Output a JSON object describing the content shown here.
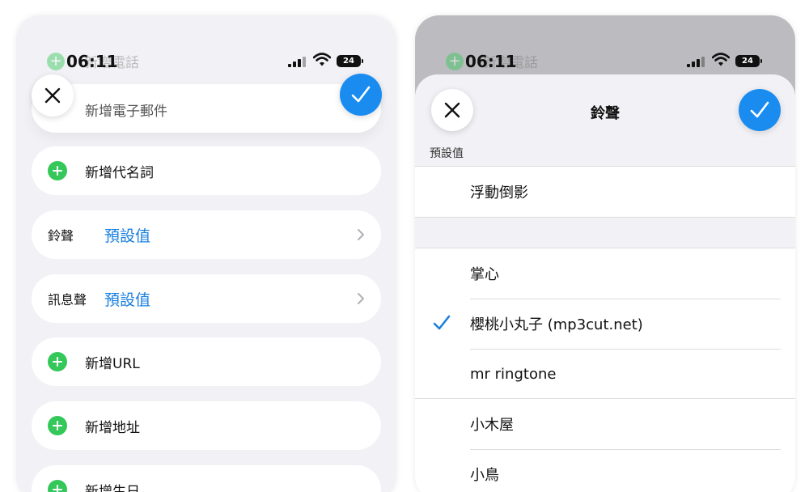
{
  "left": {
    "status": {
      "time": "06:11",
      "battery": "24"
    },
    "ghost_row_label": "新增電話",
    "email_row_label": "新增電子郵件",
    "rows": {
      "pronoun": "新增代名詞",
      "ringtone_key": "鈴聲",
      "ringtone_value": "預設值",
      "msg_key": "訊息聲",
      "msg_value": "預設值",
      "url": "新增URL",
      "address": "新增地址",
      "birthday": "新增生日"
    }
  },
  "right": {
    "status": {
      "time": "06:11",
      "battery": "24"
    },
    "ghost_row_label": "新增電話",
    "sheet_title": "鈴聲",
    "section_header": "預設值",
    "group1": [
      "浮動倒影"
    ],
    "group2": [
      "掌心",
      "櫻桃小丸子 (mp3cut.net)",
      "mr ringtone"
    ],
    "group3": [
      "小木屋",
      "小鳥"
    ],
    "selected_item": "櫻桃小丸子 (mp3cut.net)"
  },
  "colors": {
    "accent": "#1a8cf0",
    "link_blue": "#1a7fe0",
    "add_green": "#34c759",
    "background": "#f2f2f6"
  },
  "icons": [
    "close-icon",
    "checkmark-icon",
    "plus-icon",
    "chevron-right-icon",
    "signal-icon",
    "wifi-icon",
    "battery-icon"
  ]
}
